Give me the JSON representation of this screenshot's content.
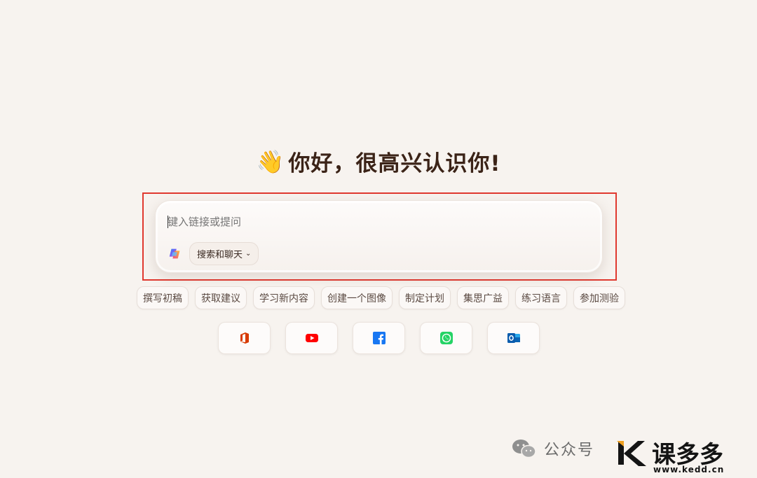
{
  "greeting": {
    "emoji": "👋",
    "title": "你好，很高兴认识你!"
  },
  "composer": {
    "placeholder": "键入链接或提问",
    "mode_label": "搜索和聊天",
    "mode_icon": "chevron-down-icon"
  },
  "suggestions": [
    "撰写初稿",
    "获取建议",
    "学习新内容",
    "创建一个图像",
    "制定计划",
    "集思广益",
    "练习语言",
    "参加测验"
  ],
  "apps": [
    {
      "name": "office-icon",
      "color": "#d83b01"
    },
    {
      "name": "youtube-icon",
      "color": "#ff0000"
    },
    {
      "name": "facebook-icon",
      "color": "#1877f2"
    },
    {
      "name": "whatsapp-icon",
      "color": "#25d366"
    },
    {
      "name": "outlook-icon",
      "color": "#0a64b4"
    }
  ],
  "watermark": {
    "channel_label": "公众号",
    "brand_name": "课多多",
    "brand_url": "www.kedd.cn"
  },
  "colors": {
    "background": "#f7f3ef",
    "highlight_border": "#e0392f"
  }
}
